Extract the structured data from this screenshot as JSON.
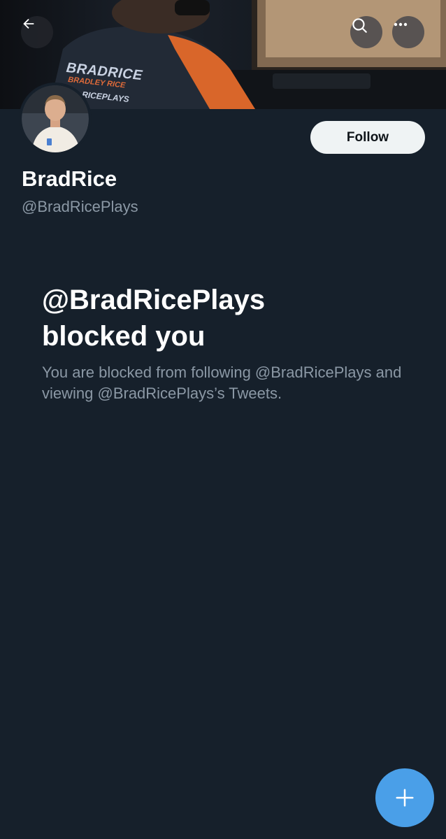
{
  "banner": {
    "shirt_line1": "BRADRICE",
    "shirt_line2": "BRADLEY RICE",
    "shirt_line3": "RICEPLAYS"
  },
  "header": {
    "back_icon": "arrow-left-icon",
    "search_icon": "search-icon",
    "more_icon": "more-horizontal-icon"
  },
  "profile": {
    "display_name": "BradRice",
    "handle": "@BradRicePlays",
    "follow_label": "Follow"
  },
  "blocked": {
    "title_line1": "@BradRicePlays",
    "title_line2": "blocked you",
    "description": "You are blocked from following @BradRicePlays and viewing @BradRicePlays’s Tweets."
  },
  "fab": {
    "icon": "plus-icon"
  },
  "colors": {
    "background": "#16202b",
    "accent": "#4a9fe8",
    "follow_button": "#eff3f4",
    "secondary_text": "#8b98a5"
  }
}
